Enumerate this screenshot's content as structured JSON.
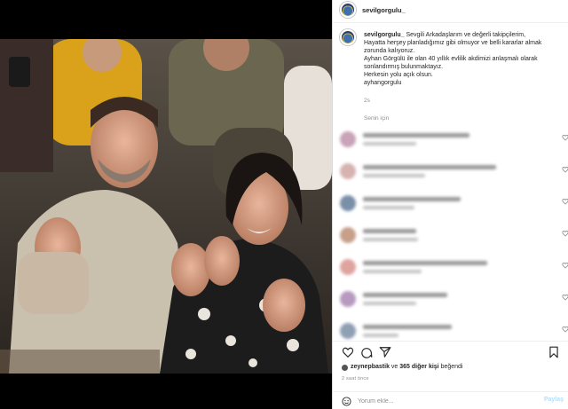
{
  "post": {
    "username": "sevilgorgulu_",
    "caption_username": "sevilgorgulu_",
    "caption_lines": [
      "Sevgili Arkadaşlarım ve değerli takipçilerim,",
      "Hayatta herşey planladığımız gibi olmuyor ve belli kararlar almak",
      "zorunda kalıyoruz.",
      "Ayhan Görgülü ile olan 40 yıllık evlilik akdimizi anlaşmalı olarak",
      "sonlandırmış bulunmaktayız.",
      "Herkesin yolu açık olsun.",
      "ayhangorgulu"
    ],
    "caption_time": "2s",
    "translate_label": "Senin için",
    "likes_user": "zeynepbastik",
    "likes_middle": " ve ",
    "likes_rest": "365 diğer kişi",
    "likes_suffix": " beğendi",
    "post_time": "2 saat önce",
    "comment_placeholder": "Yorum ekle...",
    "post_button": "Paylaş"
  },
  "comments": [
    {
      "avatar_color": "#c9a3b8"
    },
    {
      "avatar_color": "#d6b3b0"
    },
    {
      "avatar_color": "#7a8fa8"
    },
    {
      "avatar_color": "#c7a08a"
    },
    {
      "avatar_color": "#e0a4a0"
    },
    {
      "avatar_color": "#b79ac0"
    },
    {
      "avatar_color": "#8fa0b5"
    }
  ],
  "icons": {
    "like": "heart-icon",
    "comment": "comment-bubble-icon",
    "share": "paper-plane-icon",
    "save": "bookmark-icon",
    "emoji": "smiley-icon"
  },
  "colors": {
    "accent": "#0095f6",
    "muted": "#8e8e8e",
    "border": "#dbdbdb"
  }
}
